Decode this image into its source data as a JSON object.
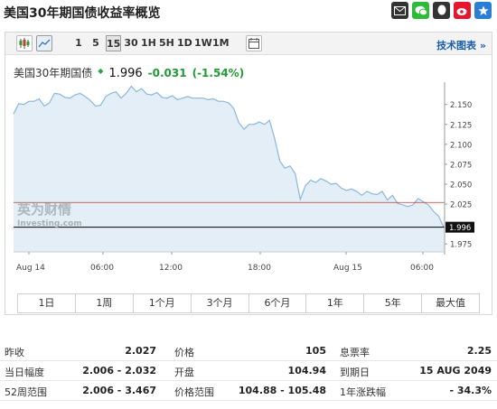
{
  "title": "美国30年期国债收益率概览",
  "share": [
    "mail-icon",
    "wechat-icon",
    "chat-icon",
    "weibo-icon",
    "star-icon"
  ],
  "toolbar": {
    "intervals": [
      "1",
      "5",
      "15",
      "30",
      "1H",
      "5H",
      "1D",
      "1W",
      "1M"
    ],
    "active": "15",
    "tech_link": "技术图表 »"
  },
  "quote": {
    "name": "美国30年期国债",
    "price": "1.996",
    "change": "-0.031",
    "change_pct": "(-1.54%)"
  },
  "chart_data": {
    "type": "area",
    "title": "",
    "x_ticks": [
      "Aug 14",
      "06:00",
      "12:00",
      "18:00",
      "Aug 15",
      "06:00"
    ],
    "y_ticks": [
      "2.150",
      "2.125",
      "2.100",
      "2.075",
      "2.050",
      "2.025",
      "1.975"
    ],
    "ylim": [
      1.965,
      2.178
    ],
    "prev_close": 2.027,
    "last": 1.996,
    "last_label": "1.996",
    "watermark_cn": "英为财情",
    "watermark_en": "Investing.com",
    "values": [
      2.138,
      2.151,
      2.15,
      2.154,
      2.154,
      2.157,
      2.148,
      2.152,
      2.164,
      2.163,
      2.159,
      2.158,
      2.162,
      2.164,
      2.16,
      2.155,
      2.148,
      2.149,
      2.16,
      2.164,
      2.166,
      2.158,
      2.164,
      2.173,
      2.166,
      2.17,
      2.163,
      2.162,
      2.165,
      2.159,
      2.158,
      2.161,
      2.156,
      2.158,
      2.16,
      2.158,
      2.158,
      2.158,
      2.156,
      2.157,
      2.154,
      2.154,
      2.152,
      2.145,
      2.127,
      2.119,
      2.125,
      2.125,
      2.128,
      2.125,
      2.13,
      2.107,
      2.079,
      2.07,
      2.073,
      2.063,
      2.031,
      2.048,
      2.055,
      2.052,
      2.057,
      2.054,
      2.05,
      2.051,
      2.045,
      2.042,
      2.044,
      2.041,
      2.036,
      2.041,
      2.038,
      2.037,
      2.041,
      2.03,
      2.036,
      2.026,
      2.024,
      2.022,
      2.024,
      2.032,
      2.028,
      2.024,
      2.016,
      2.01,
      1.996
    ]
  },
  "ranges": [
    "1日",
    "1周",
    "1个月",
    "3个月",
    "6个月",
    "1年",
    "5年",
    "最大值"
  ],
  "stats": [
    [
      {
        "label": "昨收",
        "value": "2.027"
      },
      {
        "label": "价格",
        "value": "105"
      },
      {
        "label": "息票率",
        "value": "2.25"
      }
    ],
    [
      {
        "label": "当日幅度",
        "value": "2.006 - 2.032"
      },
      {
        "label": "开盘",
        "value": "104.94"
      },
      {
        "label": "到期日",
        "value": "15 AUG 2049"
      }
    ],
    [
      {
        "label": "52周范围",
        "value": "2.006 - 3.467"
      },
      {
        "label": "价格范围",
        "value": "104.88 - 105.48"
      },
      {
        "label": "1年涨跌幅",
        "value": "- 34.3%"
      }
    ]
  ],
  "colors": {
    "area_fill": "#e3eef7",
    "area_line": "#8ab6de",
    "prev_close_line": "#c0392b",
    "last_line": "#000000"
  }
}
